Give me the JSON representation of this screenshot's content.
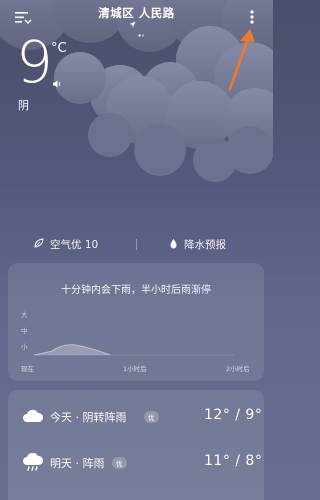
{
  "header": {
    "location": "清城区  人民路"
  },
  "current": {
    "temperature": "9",
    "unit": "°C",
    "condition": "阴"
  },
  "info_row": {
    "air_quality": "空气优 10",
    "precipitation": "降水预报"
  },
  "rain_forecast": {
    "title": "十分钟内会下雨，半小时后雨渐停",
    "levels": [
      "大",
      "中",
      "小"
    ],
    "time_labels": [
      "现在",
      "1小时后",
      "2小时后"
    ]
  },
  "daily": [
    {
      "label": "今天 · 阴转阵雨",
      "aqi_badge": "优",
      "temps": "12° / 9°",
      "icon": "cloudy-icon"
    },
    {
      "label": "明天 · 阵雨",
      "aqi_badge": "优",
      "temps": "11° / 8°",
      "icon": "rain-icon"
    }
  ],
  "colors": {
    "background_top": "#4a4d6b",
    "background_bottom": "#6a6e90",
    "cloud": "#727594",
    "annotation_arrow": "#ee7a2c"
  }
}
